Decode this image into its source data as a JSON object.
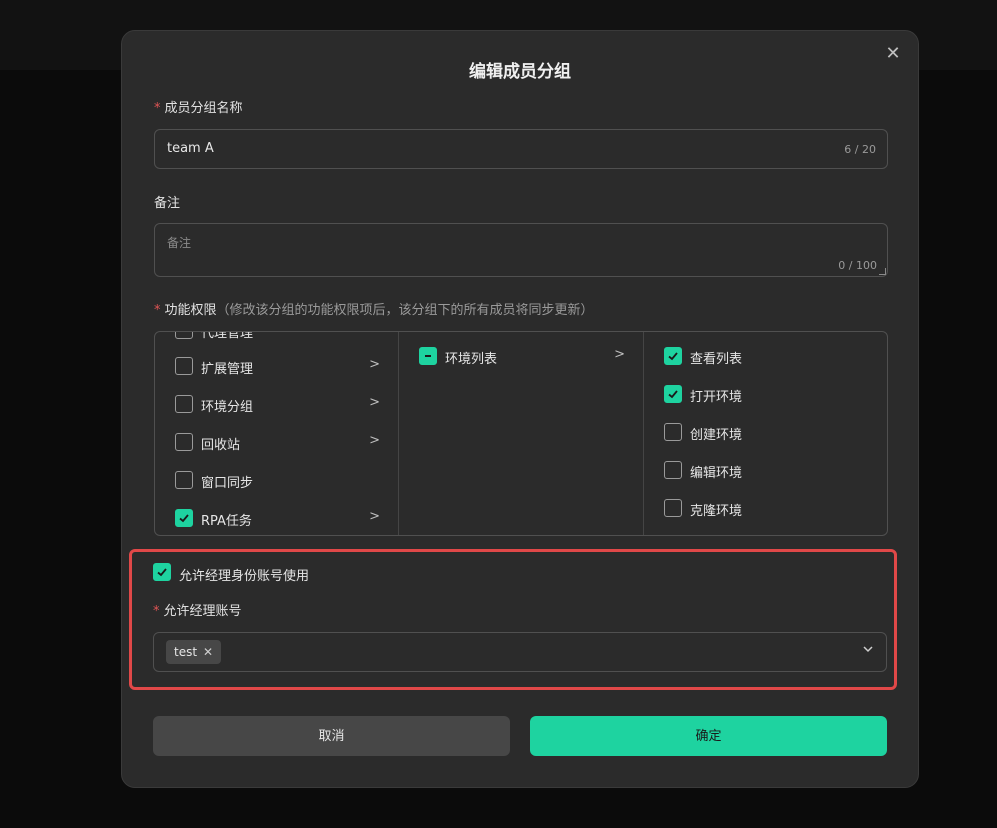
{
  "modal": {
    "title": "编辑成员分组",
    "close_icon": "close-icon"
  },
  "group_name": {
    "required_mark": "*",
    "label": "成员分组名称",
    "value": "team A",
    "count": "6 / 20"
  },
  "remark": {
    "label": "备注",
    "placeholder": "备注",
    "count": "0 / 100"
  },
  "permissions": {
    "required_mark": "*",
    "label": "功能权限",
    "hint": "（修改该分组的功能权限项后，该分组下的所有成员将同步更新）",
    "col1": [
      {
        "label": "代理管理",
        "checked": false,
        "has_children": true
      },
      {
        "label": "扩展管理",
        "checked": false,
        "has_children": true
      },
      {
        "label": "环境分组",
        "checked": false,
        "has_children": true
      },
      {
        "label": "回收站",
        "checked": false,
        "has_children": true
      },
      {
        "label": "窗口同步",
        "checked": false,
        "has_children": false
      },
      {
        "label": "RPA任务",
        "checked": true,
        "has_children": true
      }
    ],
    "col2": [
      {
        "label": "环境列表",
        "state": "partial",
        "has_children": true
      }
    ],
    "col3": [
      {
        "label": "查看列表",
        "checked": true
      },
      {
        "label": "打开环境",
        "checked": true
      },
      {
        "label": "创建环境",
        "checked": false
      },
      {
        "label": "编辑环境",
        "checked": false
      },
      {
        "label": "克隆环境",
        "checked": false
      }
    ]
  },
  "manager": {
    "allow_label": "允许经理身份账号使用",
    "allow_checked": true,
    "account_required_mark": "*",
    "account_label": "允许经理账号",
    "selected_tags": [
      "test"
    ],
    "tag_close": "✕",
    "dropdown_icon": "chevron-down-icon"
  },
  "footer": {
    "cancel_label": "取消",
    "ok_label": "确定"
  },
  "colors": {
    "accent": "#1ed3a0",
    "highlight": "#e04848",
    "required": "#e05555"
  }
}
